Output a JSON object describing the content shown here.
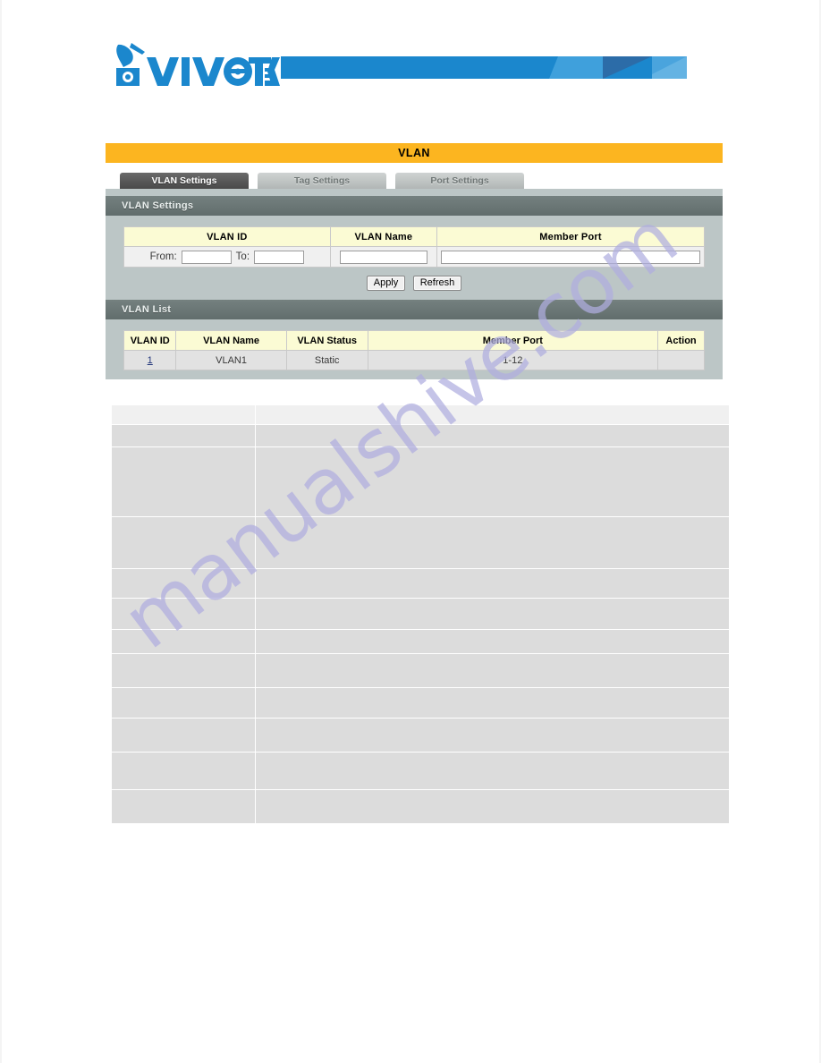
{
  "brand": {
    "logo_text": "VIVOTEK",
    "logo_icon": "vivotek-v-camera-logo",
    "banner_icon": "blue-geometric-banner"
  },
  "console": {
    "title": "VLAN",
    "tabs": [
      {
        "label": "VLAN Settings",
        "active": true
      },
      {
        "label": "Tag Settings",
        "active": false
      },
      {
        "label": "Port Settings",
        "active": false
      }
    ],
    "settings_section": {
      "header": "VLAN Settings",
      "columns": [
        "VLAN ID",
        "VLAN Name",
        "Member Port"
      ],
      "fields": {
        "from_label": "From:",
        "from_value": "",
        "to_label": "To:",
        "to_value": "",
        "vlan_name_value": "",
        "member_port_value": ""
      },
      "buttons": {
        "apply": "Apply",
        "refresh": "Refresh"
      }
    },
    "list_section": {
      "header": "VLAN List",
      "columns": [
        "VLAN ID",
        "VLAN Name",
        "VLAN Status",
        "Member Port",
        "Action"
      ],
      "rows": [
        {
          "vlan_id": "1",
          "vlan_name": "VLAN1",
          "vlan_status": "Static",
          "member_port": "1-12",
          "action": ""
        }
      ]
    }
  },
  "description_table": {
    "rows": [
      {
        "col1": "",
        "col2": "",
        "h": 22,
        "head": true
      },
      {
        "col1": "",
        "col2": "",
        "h": 25,
        "head": false
      },
      {
        "col1": "",
        "col2": "",
        "h": 78,
        "head": false
      },
      {
        "col1": "",
        "col2": "",
        "h": 58,
        "head": false
      },
      {
        "col1": "",
        "col2": "",
        "h": 33,
        "head": false
      },
      {
        "col1": "",
        "col2": "",
        "h": 35,
        "head": false
      },
      {
        "col1": "",
        "col2": "",
        "h": 27,
        "head": false
      },
      {
        "col1": "",
        "col2": "",
        "h": 38,
        "head": false
      },
      {
        "col1": "",
        "col2": "",
        "h": 34,
        "head": false
      },
      {
        "col1": "",
        "col2": "",
        "h": 38,
        "head": false
      },
      {
        "col1": "",
        "col2": "",
        "h": 42,
        "head": false
      },
      {
        "col1": "",
        "col2": "",
        "h": 38,
        "head": false
      }
    ]
  },
  "watermark": {
    "text": "manualshive.com",
    "color": "#b0aee0"
  },
  "colors": {
    "title_bar": "#fcb520",
    "panel": "#bcc6c6",
    "section_head": "#6b7776",
    "table_header": "#fbfbd4",
    "link": "#22357a",
    "brand_blue": "#1b87cd"
  }
}
